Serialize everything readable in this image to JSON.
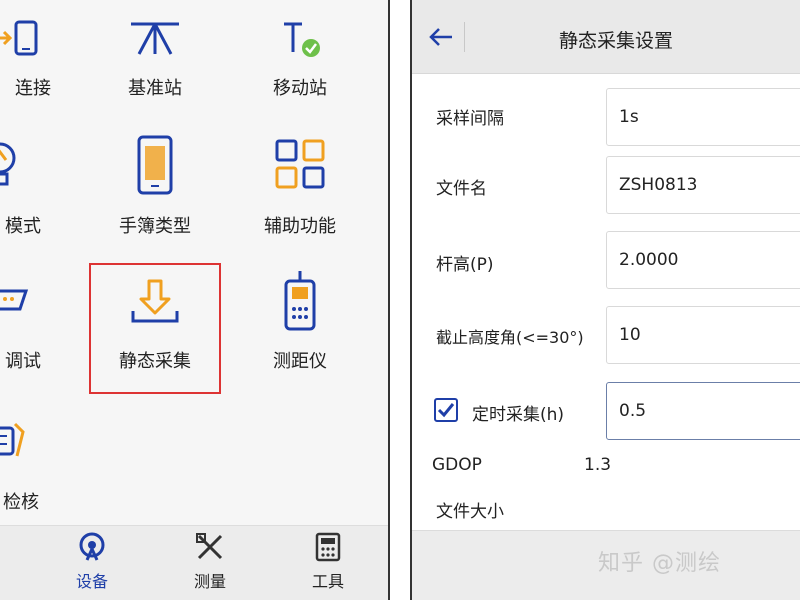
{
  "left_panel": {
    "grid": [
      {
        "label": "连接",
        "icon": "phone-connect-icon"
      },
      {
        "label": "基准站",
        "icon": "base-station-icon"
      },
      {
        "label": "移动站",
        "icon": "rover-icon"
      },
      {
        "label": "模式",
        "icon": "bulb-icon"
      },
      {
        "label": "手簿类型",
        "icon": "handheld-icon"
      },
      {
        "label": "辅助功能",
        "icon": "grid-apps-icon"
      },
      {
        "label": "调试",
        "icon": "serial-port-icon"
      },
      {
        "label": "静态采集",
        "icon": "download-icon"
      },
      {
        "label": "测距仪",
        "icon": "rangefinder-icon"
      },
      {
        "label": "检核",
        "icon": "check-tools-icon"
      }
    ],
    "nav": [
      {
        "label": "设备",
        "icon": "antenna-icon",
        "active": true
      },
      {
        "label": "测量",
        "icon": "ruler-pencil-icon",
        "active": false
      },
      {
        "label": "工具",
        "icon": "calculator-icon",
        "active": false
      }
    ],
    "accent": "#1f3fa8",
    "highlight_color": "#d33333"
  },
  "right_panel": {
    "title": "静态采集设置",
    "fields": {
      "interval_label": "采样间隔",
      "interval_value": "1s",
      "filename_label": "文件名",
      "filename_value": "ZSH0813",
      "height_label": "杆高(P)",
      "height_value": "2.0000",
      "cutoff_label": "截止高度角(<=30°)",
      "cutoff_value": "10",
      "timed_label": "定时采集(h)",
      "timed_value": "0.5",
      "timed_checked": true
    },
    "gdop_label": "GDOP",
    "gdop_value": "1.3",
    "filesize_label": "文件大小",
    "watermark": "知乎 @测绘"
  }
}
